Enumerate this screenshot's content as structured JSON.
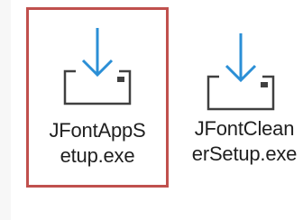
{
  "files": [
    {
      "name_line1": "JFontAppS",
      "name_line2": "etup.exe",
      "icon": "installer-download-icon",
      "selected": true
    },
    {
      "name_line1": "JFontClean",
      "name_line2": "erSetup.exe",
      "icon": "installer-download-icon",
      "selected": false
    }
  ],
  "colors": {
    "selection_border": "#c0504d",
    "arrow": "#2b8fd6",
    "tray": "#404040"
  }
}
